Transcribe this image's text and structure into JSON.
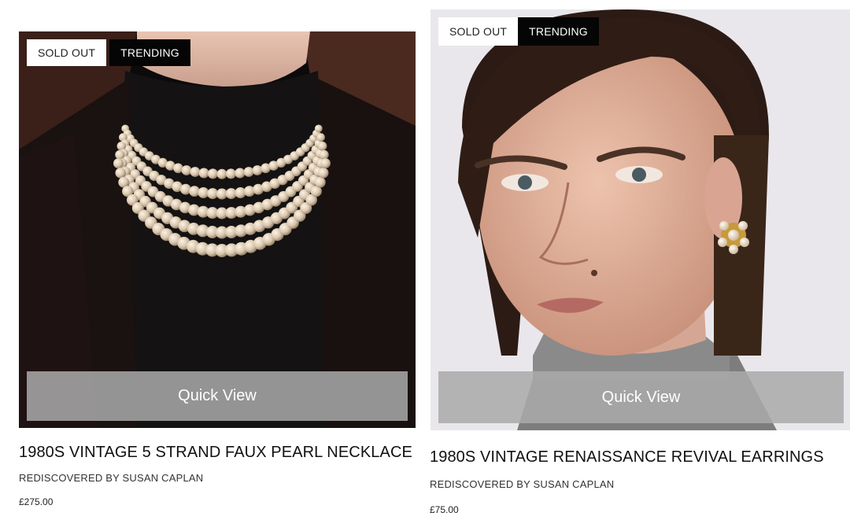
{
  "products": [
    {
      "badges": {
        "sold_out": "SOLD OUT",
        "trending": "TRENDING"
      },
      "quick_view": "Quick View",
      "title": "1980S VINTAGE 5 STRAND FAUX PEARL NECKLACE",
      "brand": "REDISCOVERED BY SUSAN CAPLAN",
      "price": "£275.00",
      "image": "model-wearing-pearl-necklace"
    },
    {
      "badges": {
        "sold_out": "SOLD OUT",
        "trending": "TRENDING"
      },
      "quick_view": "Quick View",
      "title": "1980S VINTAGE RENAISSANCE REVIVAL EARRINGS",
      "brand": "REDISCOVERED BY SUSAN CAPLAN",
      "price": "£75.00",
      "image": "model-wearing-pearl-earrings"
    }
  ],
  "colors": {
    "trending_badge_bg": "#050505",
    "sold_out_badge_bg": "#ffffff",
    "quick_view_bg": "#aaaaaa"
  }
}
